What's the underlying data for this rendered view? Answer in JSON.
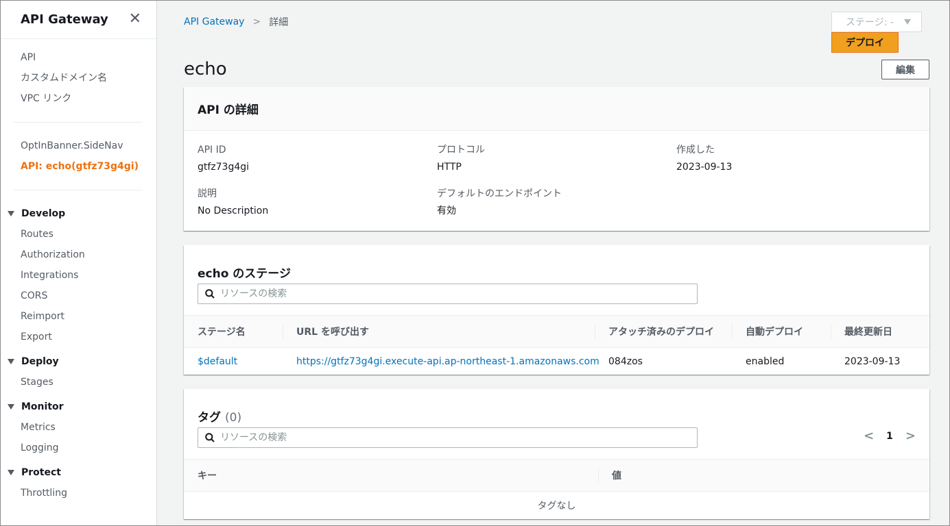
{
  "sidebar": {
    "title": "API Gateway",
    "top_links": [
      "API",
      "カスタムドメイン名",
      "VPC リンク"
    ],
    "banner": "OptInBanner.SideNav",
    "active_api": "API: echo(gtfz73g4gi)",
    "sections": [
      {
        "label": "Develop",
        "items": [
          "Routes",
          "Authorization",
          "Integrations",
          "CORS",
          "Reimport",
          "Export"
        ]
      },
      {
        "label": "Deploy",
        "items": [
          "Stages"
        ]
      },
      {
        "label": "Monitor",
        "items": [
          "Metrics",
          "Logging"
        ]
      },
      {
        "label": "Protect",
        "items": [
          "Throttling"
        ]
      }
    ]
  },
  "breadcrumb": {
    "root": "API Gateway",
    "current": "詳細"
  },
  "stage_select": {
    "value": "ステージ: -"
  },
  "deploy_label": "デプロイ",
  "page_title": "echo",
  "edit_label": "編集",
  "details": {
    "title": "API の詳細",
    "api_id_label": "API ID",
    "api_id": "gtfz73g4gi",
    "protocol_label": "プロトコル",
    "protocol": "HTTP",
    "created_label": "作成した",
    "created": "2023-09-13",
    "desc_label": "説明",
    "desc": "No Description",
    "endpoint_label": "デフォルトのエンドポイント",
    "endpoint": "有効"
  },
  "stages": {
    "title": "echo のステージ",
    "search_placeholder": "リソースの検索",
    "columns": [
      "ステージ名",
      "URL を呼び出す",
      "アタッチ済みのデプロイ",
      "自動デプロイ",
      "最終更新日"
    ],
    "rows": [
      {
        "name": "$default",
        "url": "https://gtfz73g4gi.execute-api.ap-northeast-1.amazonaws.com",
        "deployment": "084zos",
        "auto": "enabled",
        "updated": "2023-09-13"
      }
    ]
  },
  "tags": {
    "title": "タグ",
    "count": "(0)",
    "search_placeholder": "リソースの検索",
    "page": "1",
    "columns": [
      "キー",
      "値"
    ],
    "empty": "タグなし"
  }
}
